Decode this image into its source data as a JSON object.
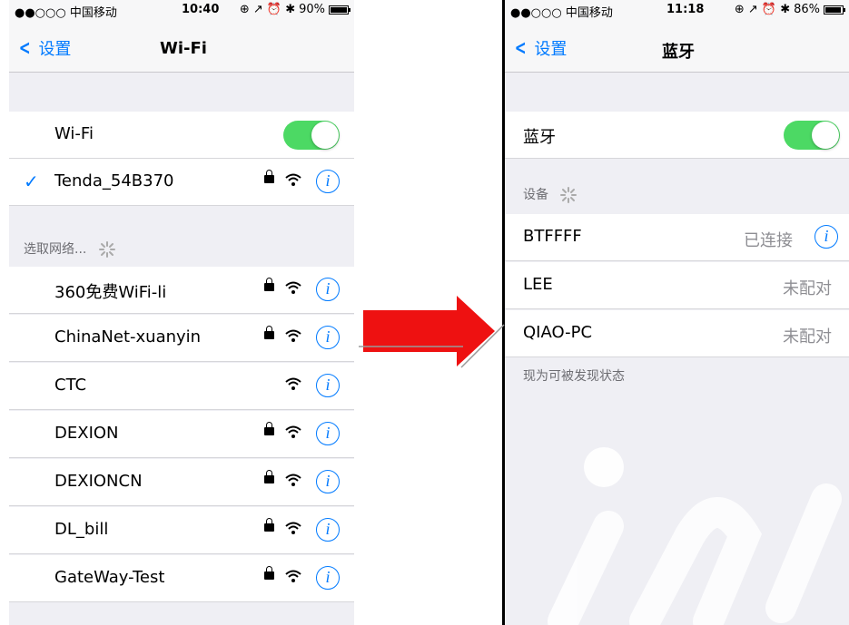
{
  "left": {
    "status": {
      "carrier": "●●○○○ 中国移动",
      "time": "10:40",
      "battery": "90%",
      "battery_level": 0.9
    },
    "nav": {
      "back_label": "设置",
      "title": "Wi-Fi"
    },
    "wifi_toggle": {
      "label": "Wi-Fi",
      "on": true
    },
    "connected": {
      "name": "Tenda_54B370"
    },
    "section_header": "选取网络...",
    "networks": [
      {
        "name": "360免费WiFi-li",
        "locked": true
      },
      {
        "name": "ChinaNet-xuanyin",
        "locked": true
      },
      {
        "name": "CTC",
        "locked": false
      },
      {
        "name": "DEXION",
        "locked": true
      },
      {
        "name": "DEXIONCN",
        "locked": true
      },
      {
        "name": "DL_bill",
        "locked": true
      },
      {
        "name": "GateWay-Test",
        "locked": true
      }
    ]
  },
  "right": {
    "status": {
      "carrier": "●●○○○ 中国移动",
      "time": "11:18",
      "battery": "86%",
      "battery_level": 0.86
    },
    "nav": {
      "back_label": "设置",
      "title": "蓝牙"
    },
    "bt_toggle": {
      "label": "蓝牙",
      "on": true
    },
    "devices_header": "设备",
    "devices": [
      {
        "name": "BTFFFF",
        "status": "已连接",
        "info": true
      },
      {
        "name": "LEE",
        "status": "未配对",
        "info": false
      },
      {
        "name": "QIAO-PC",
        "status": "未配对",
        "info": false
      }
    ],
    "footer": "现为可被发现状态"
  },
  "colors": {
    "accent": "#007aff",
    "toggle_on": "#4cd964",
    "arrow": "#ee1111"
  }
}
